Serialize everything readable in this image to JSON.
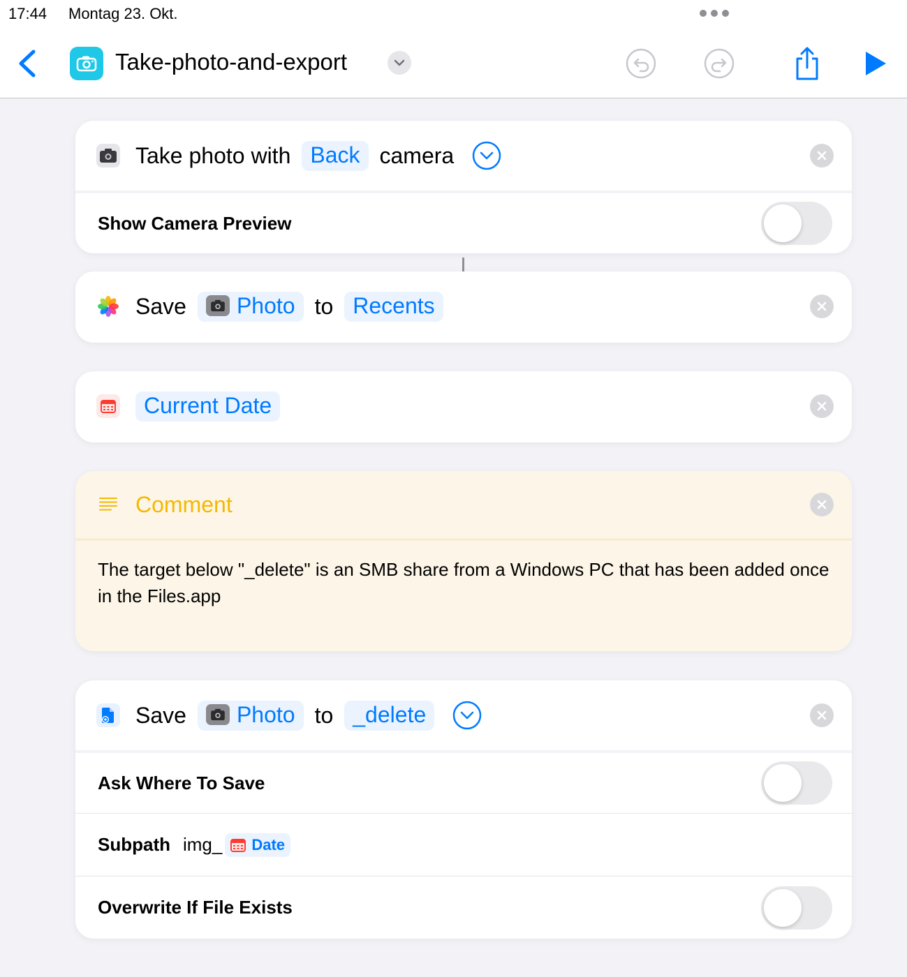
{
  "status": {
    "time": "17:44",
    "date": "Montag 23. Okt."
  },
  "nav": {
    "title": "Take-photo-and-export",
    "icons": {
      "back": "chevron-left-icon",
      "app": "camera-icon",
      "title_menu": "chevron-down-icon",
      "undo": "undo-icon",
      "redo": "redo-icon",
      "share": "share-icon",
      "run": "play-icon"
    }
  },
  "actions": {
    "take_photo": {
      "text1": "Take photo with",
      "camera_token": "Back",
      "text2": "camera",
      "option_label": "Show Camera Preview",
      "option_on": false
    },
    "save_photos": {
      "verb": "Save",
      "item_token": "Photo",
      "to": "to",
      "album_token": "Recents"
    },
    "current_date": {
      "token": "Current Date"
    },
    "comment": {
      "title": "Comment",
      "text": "The target below \"_delete\" is an SMB share from a Windows PC that has been added once in the Files.app"
    },
    "save_file": {
      "verb": "Save",
      "item_token": "Photo",
      "to": "to",
      "destination_token": "_delete",
      "ask_label": "Ask Where To Save",
      "ask_on": false,
      "subpath_label": "Subpath",
      "subpath_prefix": "img_",
      "subpath_token": "Date",
      "overwrite_label": "Overwrite If File Exists",
      "overwrite_on": false
    }
  },
  "colors": {
    "accent": "#007aff",
    "comment_title": "#f5b800",
    "comment_bg": "#fdf6e8",
    "app_icon": "#1fc8e6"
  }
}
